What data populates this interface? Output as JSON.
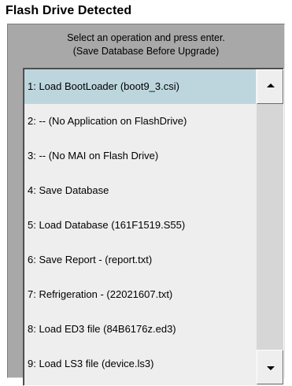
{
  "dialog": {
    "title": "Flash Drive Detected",
    "instruction_line1": "Select an operation and press enter.",
    "instruction_line2": "(Save Database Before Upgrade)"
  },
  "list": {
    "selected_index": 0,
    "items": [
      {
        "label": "1: Load BootLoader (boot9_3.csi)"
      },
      {
        "label": "2: -- (No Application on FlashDrive)"
      },
      {
        "label": "3: -- (No MAI on Flash Drive)"
      },
      {
        "label": "4: Save Database"
      },
      {
        "label": "5: Load Database (161F1519.S55)"
      },
      {
        "label": "6: Save Report - (report.txt)"
      },
      {
        "label": "7: Refrigeration - (22021607.txt)"
      },
      {
        "label": "8: Load ED3 file (84B6176z.ed3)"
      },
      {
        "label": "9: Load LS3 file (device.ls3)"
      }
    ]
  },
  "scrollbar": {
    "up_icon": "triangle-up-icon",
    "down_icon": "triangle-down-icon"
  },
  "colors": {
    "panel_bg": "#a8a8a8",
    "list_bg": "#eeeeee",
    "selection_bg": "#bdd6de"
  }
}
